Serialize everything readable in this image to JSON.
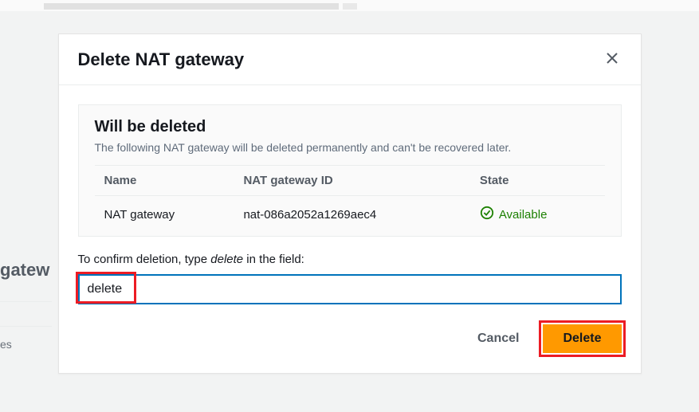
{
  "background": {
    "sidebar_heading_fragment": "gatew",
    "sidebar_sub_fragment": "es"
  },
  "modal": {
    "title": "Delete NAT gateway",
    "info_title": "Will be deleted",
    "info_desc": "The following NAT gateway will be deleted permanently and can't be recovered later.",
    "columns": {
      "name": "Name",
      "id": "NAT gateway ID",
      "state": "State"
    },
    "row": {
      "name": "NAT gateway",
      "id": "nat-086a2052a1269aec4",
      "state": "Available"
    },
    "confirm_prefix": "To confirm deletion, type ",
    "confirm_keyword": "delete",
    "confirm_suffix": " in the field:",
    "input_value": "delete",
    "footer": {
      "cancel": "Cancel",
      "delete": "Delete"
    }
  }
}
